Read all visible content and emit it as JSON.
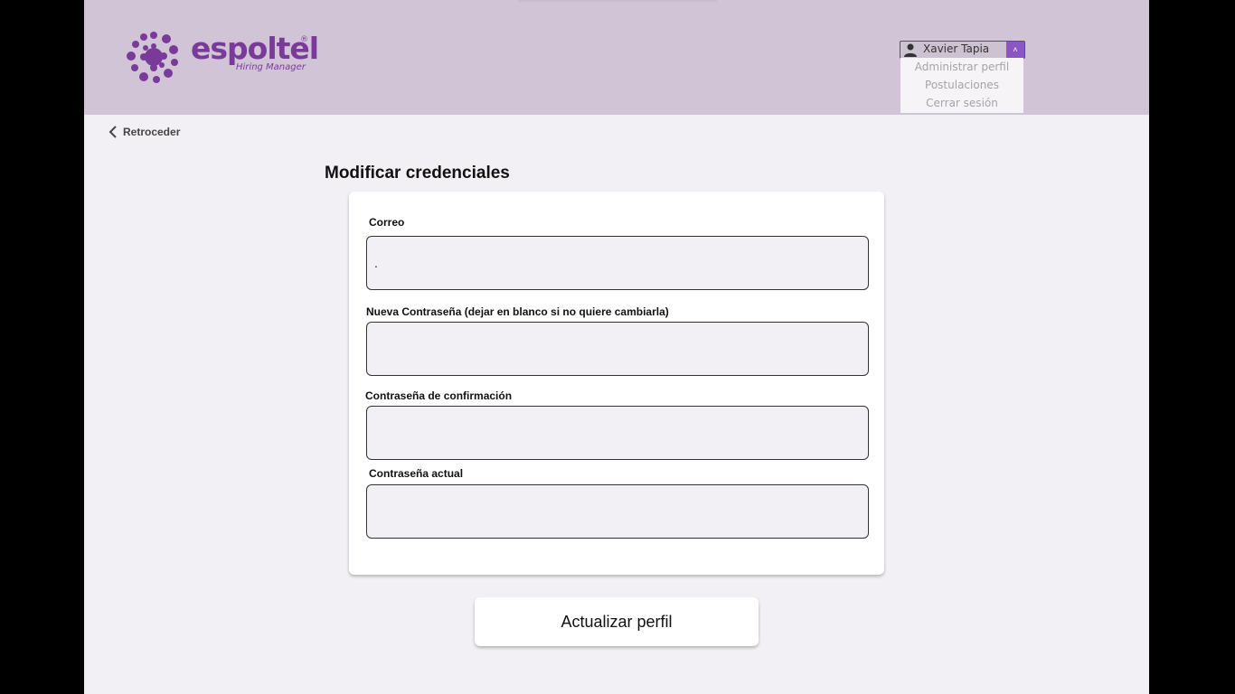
{
  "brand": {
    "name": "espoltel",
    "registered_mark": "®",
    "subtitle": "Hiring Manager",
    "color": "#7a3a9a"
  },
  "user_menu": {
    "user_name": "Xavier Tapia",
    "toggle_symbol": "˄",
    "items": [
      {
        "label": "Administrar perfil"
      },
      {
        "label": "Postulaciones"
      },
      {
        "label": "Cerrar sesión"
      }
    ]
  },
  "nav": {
    "back_label": "Retroceder"
  },
  "form": {
    "title": "Modificar credenciales",
    "fields": [
      {
        "label": "Correo",
        "value": "."
      },
      {
        "label": "Nueva Contraseña (dejar en blanco si no quiere cambiarla)",
        "value": ""
      },
      {
        "label": "Contraseña de confirmación",
        "value": ""
      },
      {
        "label": "Contraseña actual",
        "value": ""
      }
    ],
    "submit_label": "Actualizar perfil"
  },
  "colors": {
    "header_bg": "#d0c4d6",
    "page_bg": "#f2f0f4",
    "accent": "#8c56c4"
  },
  "icons": {
    "user": "user-icon",
    "back": "chevron-left-icon",
    "menu_toggle": "chevron-up-icon"
  }
}
